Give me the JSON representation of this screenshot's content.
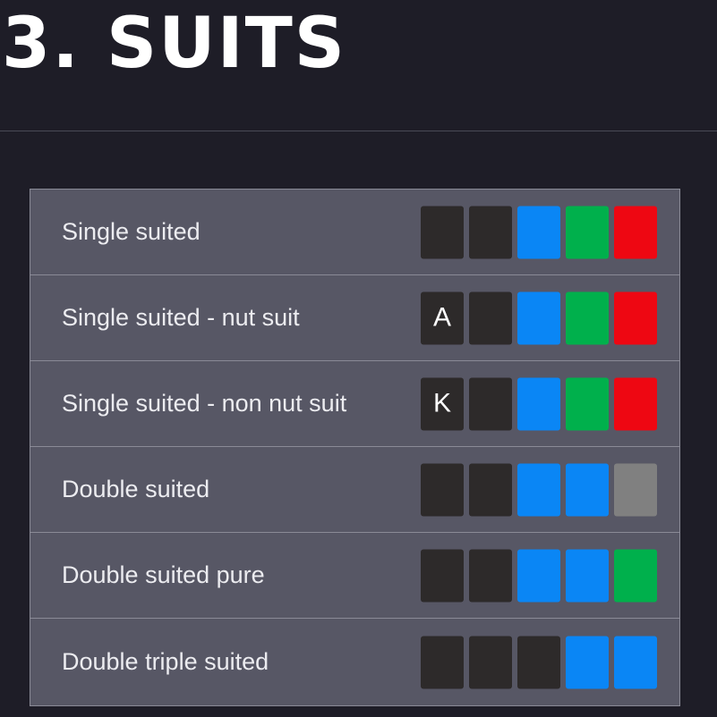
{
  "title": "3. SUITS",
  "colors": {
    "background": "#1e1d27",
    "panel": "#575765",
    "dark": "#2d2a2a",
    "blue": "#0a86f5",
    "green": "#00b04c",
    "red": "#ee0712",
    "gray": "#808080"
  },
  "rows": [
    {
      "label": "Single suited",
      "cards": [
        {
          "color": "dark",
          "text": ""
        },
        {
          "color": "dark",
          "text": ""
        },
        {
          "color": "blue",
          "text": ""
        },
        {
          "color": "green",
          "text": ""
        },
        {
          "color": "red",
          "text": ""
        }
      ]
    },
    {
      "label": "Single suited - nut suit",
      "cards": [
        {
          "color": "dark",
          "text": "A"
        },
        {
          "color": "dark",
          "text": ""
        },
        {
          "color": "blue",
          "text": ""
        },
        {
          "color": "green",
          "text": ""
        },
        {
          "color": "red",
          "text": ""
        }
      ]
    },
    {
      "label": "Single suited - non nut suit",
      "cards": [
        {
          "color": "dark",
          "text": "K"
        },
        {
          "color": "dark",
          "text": ""
        },
        {
          "color": "blue",
          "text": ""
        },
        {
          "color": "green",
          "text": ""
        },
        {
          "color": "red",
          "text": ""
        }
      ]
    },
    {
      "label": "Double suited",
      "cards": [
        {
          "color": "dark",
          "text": ""
        },
        {
          "color": "dark",
          "text": ""
        },
        {
          "color": "blue",
          "text": ""
        },
        {
          "color": "blue",
          "text": ""
        },
        {
          "color": "gray",
          "text": ""
        }
      ]
    },
    {
      "label": "Double suited pure",
      "cards": [
        {
          "color": "dark",
          "text": ""
        },
        {
          "color": "dark",
          "text": ""
        },
        {
          "color": "blue",
          "text": ""
        },
        {
          "color": "blue",
          "text": ""
        },
        {
          "color": "green",
          "text": ""
        }
      ]
    },
    {
      "label": "Double triple suited",
      "cards": [
        {
          "color": "dark",
          "text": ""
        },
        {
          "color": "dark",
          "text": ""
        },
        {
          "color": "dark",
          "text": ""
        },
        {
          "color": "blue",
          "text": ""
        },
        {
          "color": "blue",
          "text": ""
        }
      ]
    }
  ]
}
